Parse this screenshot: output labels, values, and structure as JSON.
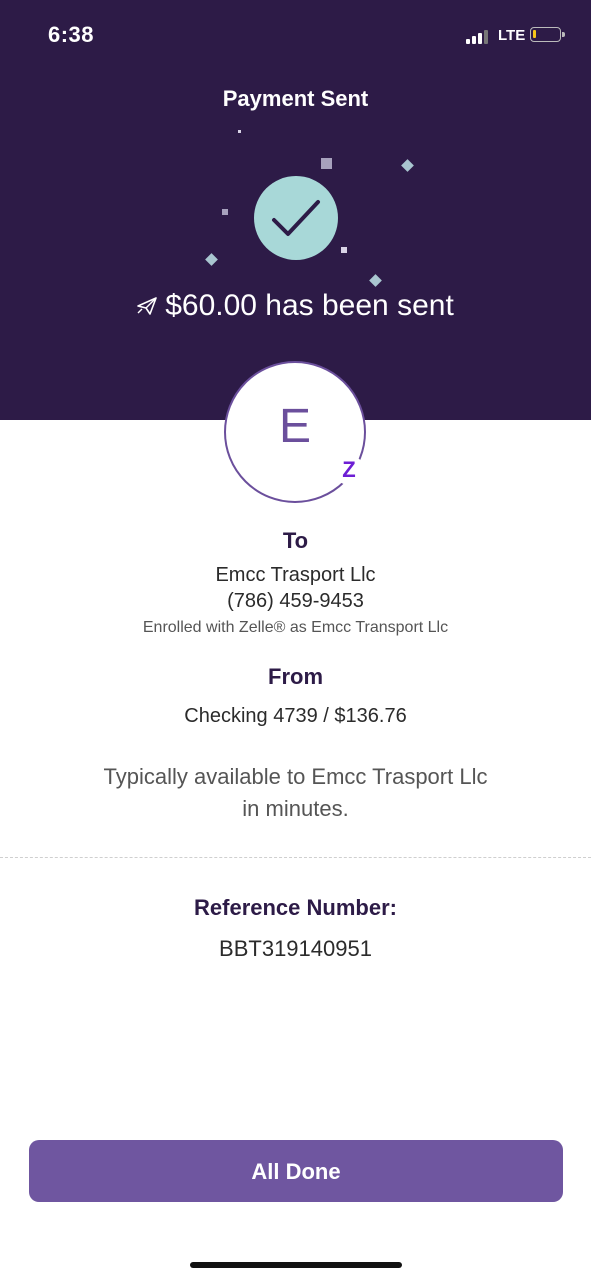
{
  "status_bar": {
    "time": "6:38",
    "network": "LTE",
    "signal_bars_active": 3,
    "battery_level_percent": 10,
    "battery_color": "#f5c518"
  },
  "header": {
    "title": "Payment Sent",
    "background_color": "#2d1b47",
    "check_icon": "check-icon",
    "sent_icon": "paper-plane-icon",
    "amount_message": "$60.00 has been sent"
  },
  "recipient": {
    "avatar_letter": "E",
    "badge_icon": "zelle-icon",
    "badge_text": "Z",
    "to_label": "To",
    "name": "Emcc Trasport Llc",
    "phone": "(786) 459-9453",
    "enrolled_text": "Enrolled with Zelle® as Emcc Transport Llc"
  },
  "sender": {
    "from_label": "From",
    "account": "Checking 4739 / $136.76"
  },
  "availability": {
    "line1": "Typically available to Emcc Trasport Llc",
    "line2": "in minutes."
  },
  "reference": {
    "label": "Reference Number:",
    "value": "BBT319140951"
  },
  "actions": {
    "done_label": "All Done",
    "accent_color": "#6f56a0"
  }
}
